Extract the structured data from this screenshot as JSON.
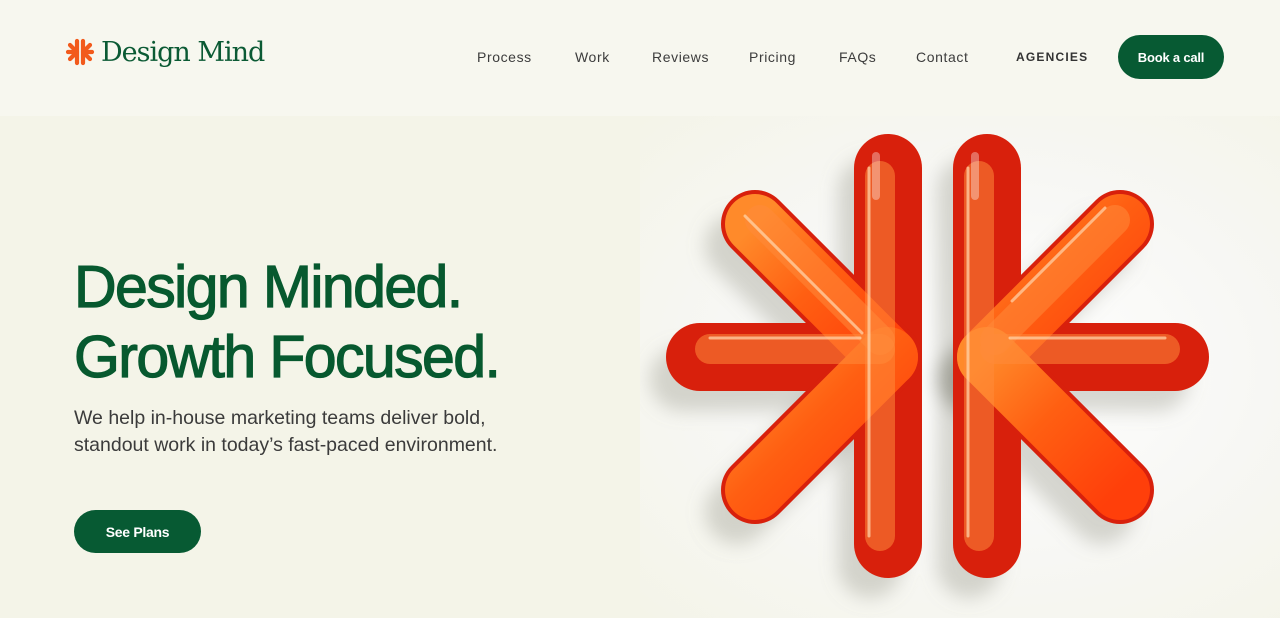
{
  "brand": {
    "name": "Design Mind",
    "accent_color": "#075a33",
    "mark_color": "#f25a1c",
    "logo_icon": "asterisk-burst-icon"
  },
  "nav": {
    "items": [
      {
        "label": "Process"
      },
      {
        "label": "Work"
      },
      {
        "label": "Reviews"
      },
      {
        "label": "Pricing"
      },
      {
        "label": "FAQs"
      },
      {
        "label": "Contact"
      },
      {
        "label": "AGENCIES"
      }
    ],
    "cta_label": "Book a call"
  },
  "hero": {
    "title_line1": "Design Minded.",
    "title_line2": "Growth Focused.",
    "subtitle": "We help in-house marketing teams deliver bold, standout work in today’s fast-paced environment.",
    "cta_label": "See Plans",
    "art_icon": "glossy-asterisk-icon",
    "art_color": "#ff5a14"
  }
}
